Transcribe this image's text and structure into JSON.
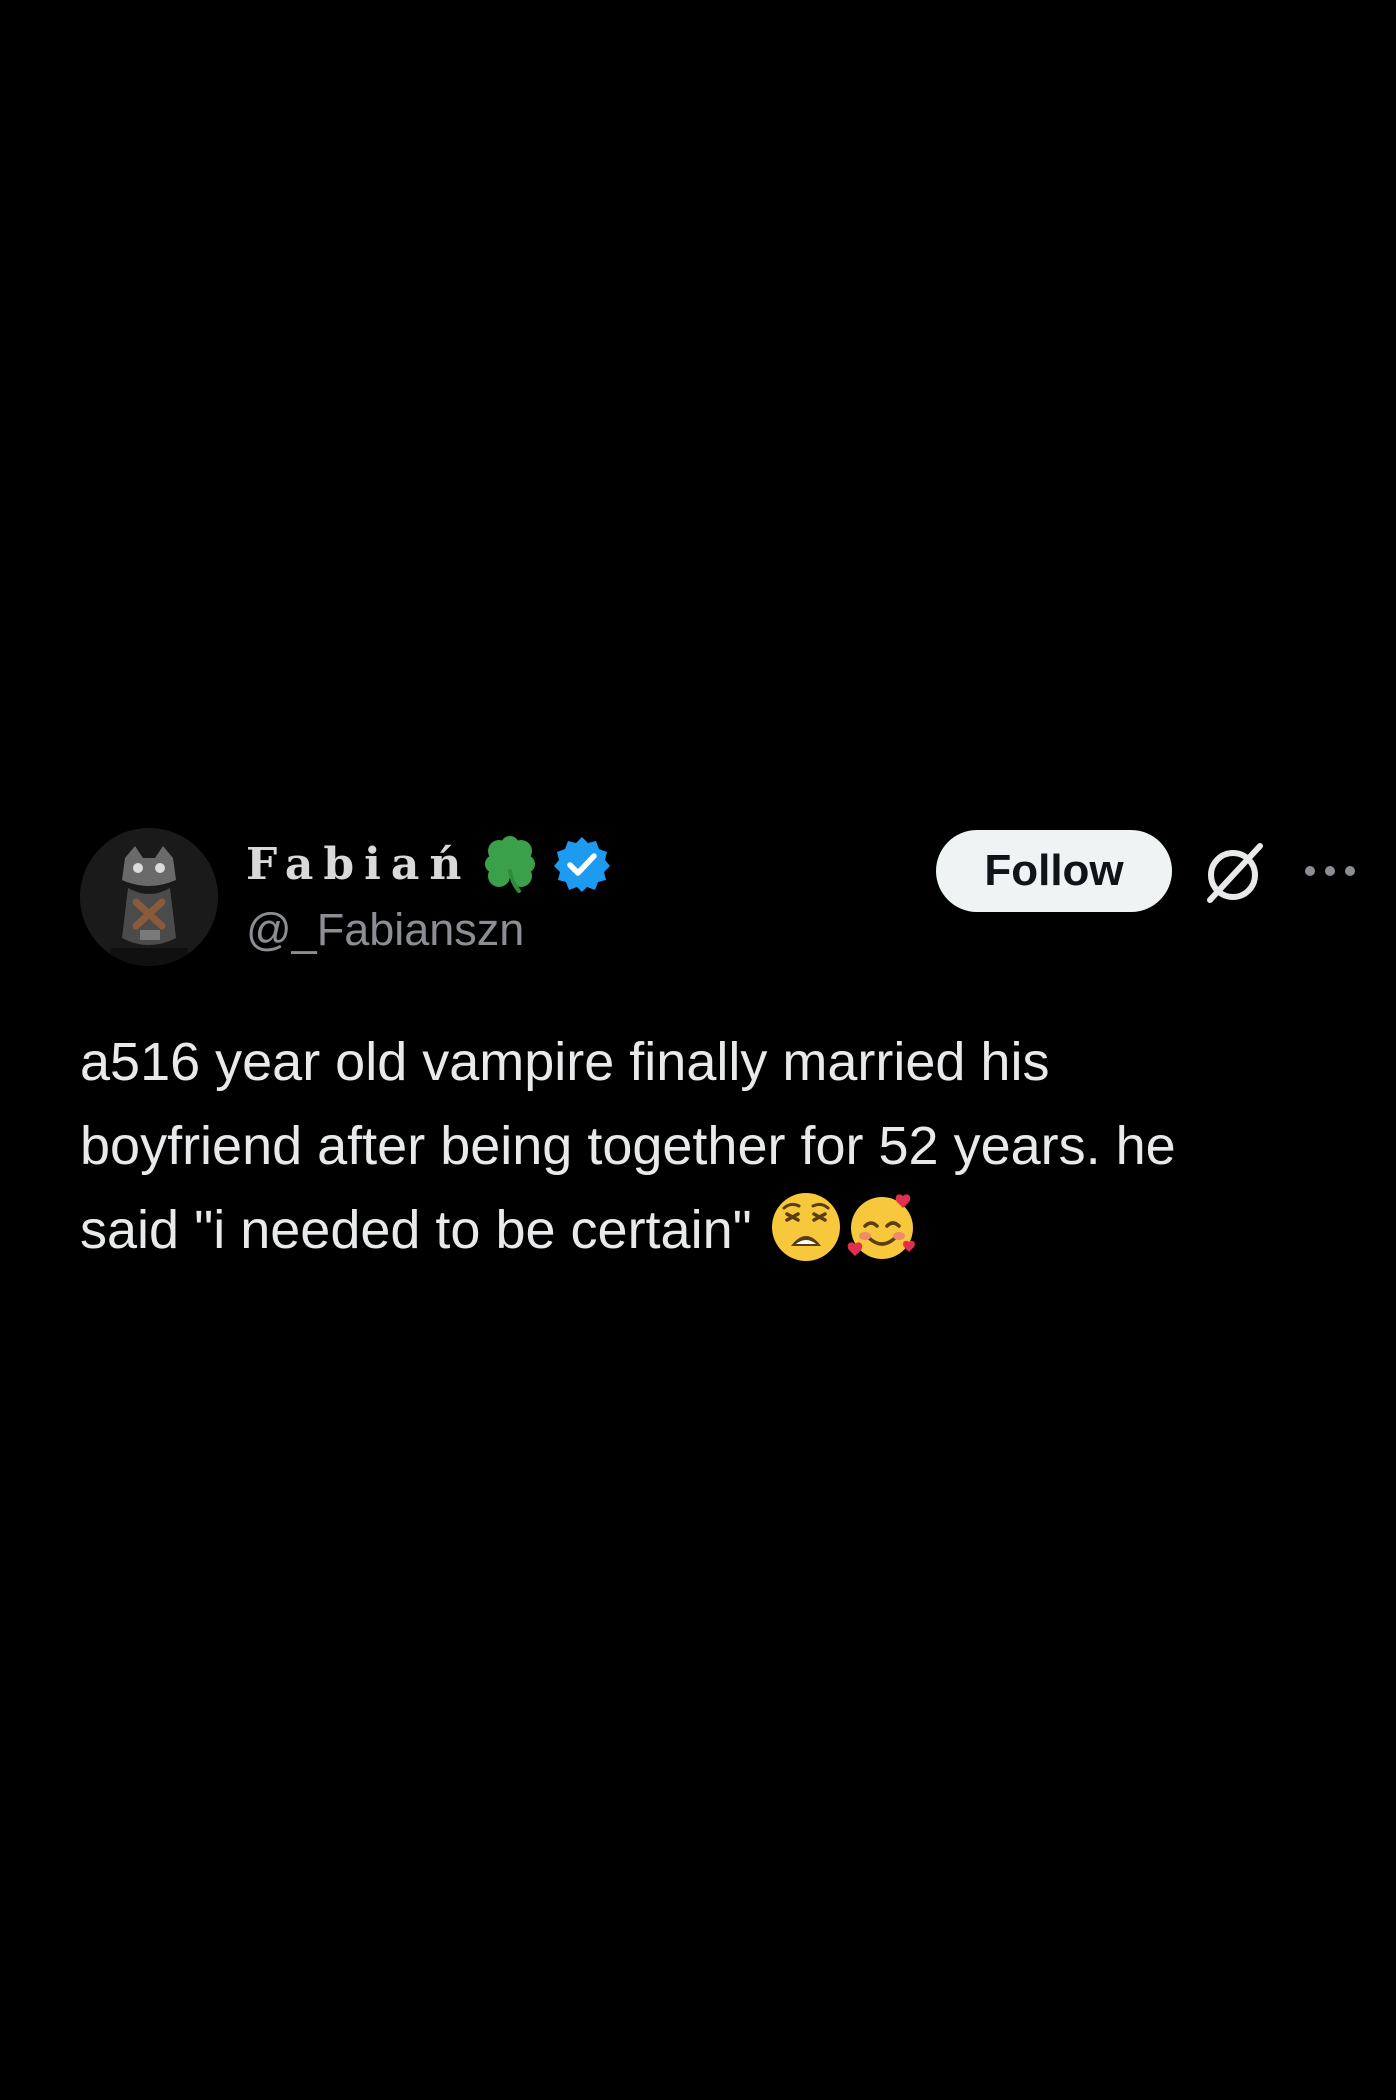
{
  "tweet": {
    "author": {
      "display_name": "Fabiań",
      "handle": "@_Fabianszn",
      "avatar_icon": "avatar-photo",
      "clover_icon": "four-leaf-clover-icon",
      "verified_icon": "verified-badge-icon"
    },
    "follow_label": "Follow",
    "text_lines": [
      "a516 year old vampire finally married  his",
      "boyfriend after being together for 52 years. he",
      "said \"i needed to be certain\""
    ],
    "emojis": [
      "weary-face-emoji",
      "smiling-face-with-hearts-emoji"
    ]
  },
  "colors": {
    "background": "#000000",
    "text": "#e7e9ea",
    "handle": "#8b8f94",
    "follow_bg": "#eff3f4",
    "verified": "#1d9bf0",
    "clover": "#3ba04a"
  }
}
